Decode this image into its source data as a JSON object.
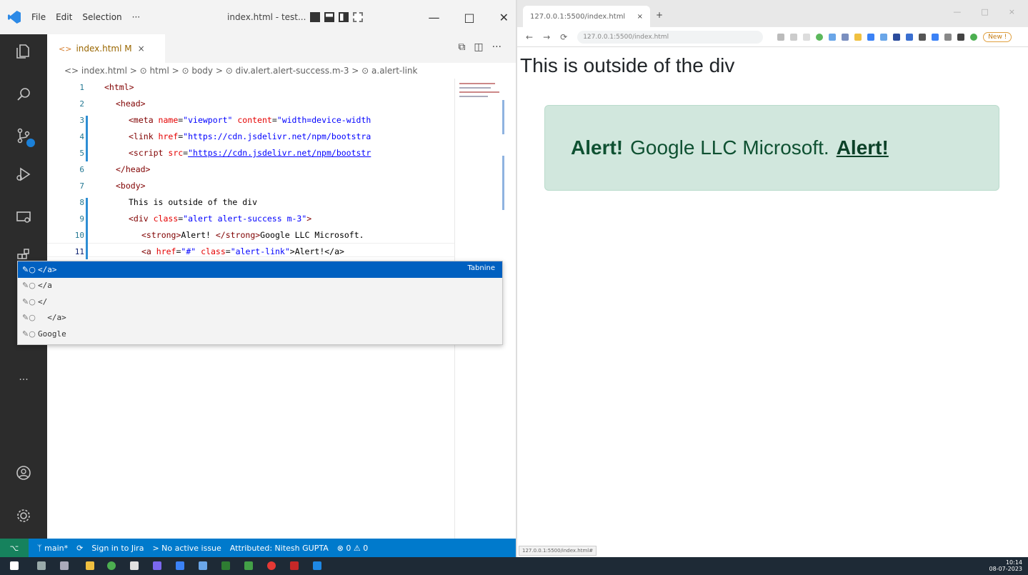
{
  "vscode": {
    "menu": [
      "File",
      "Edit",
      "Selection",
      "···"
    ],
    "window_title": "index.html - test...",
    "tab": {
      "label": "index.html M",
      "close": "×"
    },
    "breadcrumb": "<> index.html > ⊙ html > ⊙ body > ⊙ div.alert.alert-success.m-3 > ⊙ a.alert-link",
    "code_lines": [
      {
        "num": "1"
      },
      {
        "num": "2"
      },
      {
        "num": "3"
      },
      {
        "num": "4"
      },
      {
        "num": "5"
      },
      {
        "num": "6"
      },
      {
        "num": "7"
      },
      {
        "num": "8"
      },
      {
        "num": "9"
      },
      {
        "num": "10"
      },
      {
        "num": "11"
      }
    ],
    "code": {
      "l1": "<html>",
      "l2": "<head>",
      "l3_tag": "<meta ",
      "l3_attr": "name",
      "l3_val": "\"viewport\"",
      "l3_attr2": " content",
      "l3_val2": "\"width=device-width",
      "l4_tag": "<link ",
      "l4_attr": "href",
      "l4_val": "\"https://cdn.jsdelivr.net/npm/bootstra",
      "l5_tag": "<script ",
      "l5_attr": "src",
      "l5_val": "\"https://cdn.jsdelivr.net/npm/bootstr",
      "l6": "</head>",
      "l7": "<body>",
      "l8": "This is outside of the div",
      "l9_tag": "<div ",
      "l9_attr": "class",
      "l9_val": "\"alert alert-success m-3\"",
      "l9_end": ">",
      "l10_tag": "<strong>",
      "l10_txt": "Alert! ",
      "l10_tag2": "</strong>",
      "l10_txt2": "Google LLC Microsoft.",
      "l11_tag": "<a ",
      "l11_attr": "href",
      "l11_val": "\"#\"",
      "l11_attr2": " class",
      "l11_val2": "\"alert-link\"",
      "l11_txt": ">Alert!</a>"
    },
    "suggestions": [
      {
        "label": "</a>",
        "detail": "Tabnine"
      },
      {
        "label": "</a"
      },
      {
        "label": "</"
      },
      {
        "label": "  </a>"
      },
      {
        "label": "Google"
      }
    ],
    "statusbar": {
      "remote": "⌥",
      "branch": "main*",
      "sync": "⟳",
      "sign_in": "Sign in to Jira",
      "issue": "> No active issue",
      "author": "Attributed: Nitesh GUPTA",
      "problems": "⊗ 0 ⚠ 0"
    }
  },
  "browser": {
    "tab_title": "127.0.0.1:5500/index.html",
    "tab_close": "×",
    "new_tab": "+",
    "window_controls": [
      "—",
      "□",
      "×"
    ],
    "nav": [
      "←",
      "→",
      "⟳"
    ],
    "url": "127.0.0.1:5500/index.html",
    "update_label": "New !",
    "page": {
      "outside_text": "This is outside of the div",
      "alert_strong": "Alert!",
      "alert_text": "Google LLC Microsoft.",
      "alert_link": "Alert!"
    },
    "status_url": "127.0.0.1:5500/index.html#"
  },
  "taskbar": {
    "time": "10:14",
    "date": "08-07-2023"
  },
  "colors": {
    "vscode_accent": "#007acc",
    "alert_bg": "#d1e7dd",
    "alert_text": "#0f5132",
    "suggest_active": "#0060c0"
  }
}
